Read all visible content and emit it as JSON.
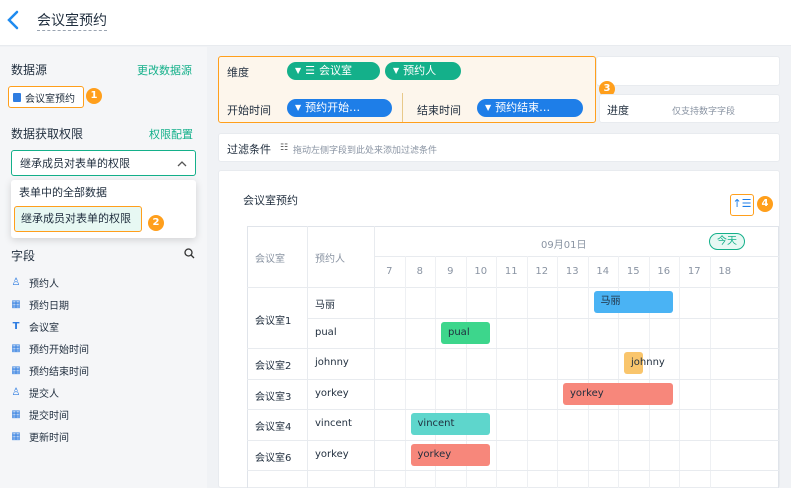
{
  "header": {
    "back_icon": "chevron-left-icon",
    "title": "会议室预约"
  },
  "sidebar": {
    "datasource_label": "数据源",
    "change_datasource": "更改数据源",
    "datasource_item": "会议室预约",
    "badge1": "1",
    "permission_label": "数据获取权限",
    "permission_config": "权限配置",
    "permission_value": "继承成员对表单的权限",
    "dropdown_options": [
      "表单中的全部数据",
      "继承成员对表单的权限"
    ],
    "badge2": "2",
    "fields_label": "字段",
    "fields": [
      {
        "icon": "person-icon",
        "label": "预约人"
      },
      {
        "icon": "calendar-icon",
        "label": "预约日期"
      },
      {
        "icon": "text-icon",
        "label": "会议室"
      },
      {
        "icon": "calendar-icon",
        "label": "预约开始时间"
      },
      {
        "icon": "calendar-icon",
        "label": "预约结束时间"
      },
      {
        "icon": "person-icon",
        "label": "提交人"
      },
      {
        "icon": "calendar-icon",
        "label": "提交时间"
      },
      {
        "icon": "calendar-icon",
        "label": "更新时间"
      }
    ]
  },
  "config": {
    "dimension_label": "维度",
    "dimension_pills": [
      "会议室",
      "预约人"
    ],
    "start_label": "开始时间",
    "start_pill": "预约开始…",
    "end_label": "结束时间",
    "end_pill": "预约结束…",
    "badge3": "3",
    "progress_label": "进度",
    "progress_hint": "仅支持数字字段",
    "filter_label": "过滤条件",
    "filter_hint": "拖动左侧字段到此处来添加过滤条件"
  },
  "chart": {
    "title": "会议室预约",
    "badge4": "4",
    "col_room": "会议室",
    "col_person": "预约人",
    "date_label": "09月01日",
    "today_button": "今天",
    "hours": [
      "7",
      "8",
      "9",
      "10",
      "11",
      "12",
      "13",
      "14",
      "15",
      "16",
      "17",
      "18"
    ]
  },
  "chart_data": {
    "type": "gantt",
    "rows": [
      {
        "room": "会议室1",
        "person": "马丽",
        "start": 14.0,
        "end": 17.0,
        "color": "#4ab3f4"
      },
      {
        "room": "会议室1",
        "person": "pual",
        "start": 9.0,
        "end": 11.0,
        "color": "#3dd68c"
      },
      {
        "room": "会议室2",
        "person": "johnny",
        "start": 15.0,
        "end": 16.0,
        "color": "#f9c56c"
      },
      {
        "room": "会议室3",
        "person": "yorkey",
        "start": 13.0,
        "end": 17.0,
        "color": "#f7877b"
      },
      {
        "room": "会议室4",
        "person": "vincent",
        "start": 8.0,
        "end": 11.0,
        "color": "#5ed6cc"
      },
      {
        "room": "会议室6",
        "person": "yorkey",
        "start": 8.0,
        "end": 11.0,
        "color": "#f7877b"
      }
    ]
  }
}
